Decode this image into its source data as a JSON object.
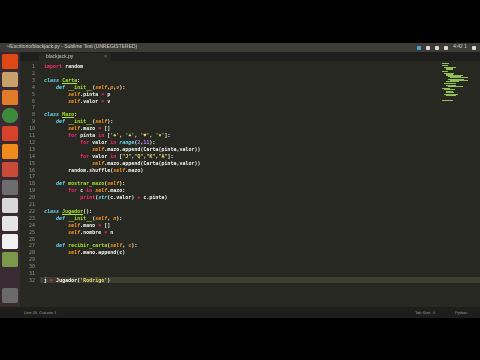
{
  "window": {
    "title": "~/Escritorio/blackjack.py - Sublime Text (UNREGISTERED)",
    "tray_time": "4:42 1"
  },
  "tabs": [
    {
      "label": "blackjack.py"
    }
  ],
  "editor": {
    "line_numbers": [
      "1",
      "2",
      "3",
      "4",
      "5",
      "6",
      "7",
      "8",
      "9",
      "10",
      "11",
      "12",
      "13",
      "14",
      "15",
      "16",
      "17",
      "18",
      "19",
      "20",
      "21",
      "22",
      "23",
      "24",
      "25",
      "26",
      "27",
      "28",
      "29",
      "30",
      "31",
      "32"
    ],
    "lines": [
      [
        {
          "t": "import",
          "c": "kw"
        },
        {
          "t": " random",
          "c": ""
        }
      ],
      [],
      [
        {
          "t": "class ",
          "c": "df"
        },
        {
          "t": "Carta",
          "c": "cls"
        },
        {
          "t": ":",
          "c": ""
        }
      ],
      [
        {
          "t": "    def ",
          "c": "df"
        },
        {
          "t": "__init__",
          "c": "fn"
        },
        {
          "t": "(",
          "c": ""
        },
        {
          "t": "self",
          "c": "pm"
        },
        {
          "t": ",",
          "c": ""
        },
        {
          "t": "p",
          "c": "pm"
        },
        {
          "t": ",",
          "c": ""
        },
        {
          "t": "v",
          "c": "pm"
        },
        {
          "t": "):",
          "c": ""
        }
      ],
      [
        {
          "t": "        self",
          "c": "slf"
        },
        {
          "t": ".pinta ",
          "c": ""
        },
        {
          "t": "=",
          "c": "kw"
        },
        {
          "t": " p",
          "c": ""
        }
      ],
      [
        {
          "t": "        self",
          "c": "slf"
        },
        {
          "t": ".valor ",
          "c": ""
        },
        {
          "t": "=",
          "c": "kw"
        },
        {
          "t": " v",
          "c": ""
        }
      ],
      [],
      [
        {
          "t": "class ",
          "c": "df"
        },
        {
          "t": "Mazo",
          "c": "cls"
        },
        {
          "t": ":",
          "c": ""
        }
      ],
      [
        {
          "t": "    def ",
          "c": "df"
        },
        {
          "t": "__init__",
          "c": "fn"
        },
        {
          "t": "(",
          "c": ""
        },
        {
          "t": "self",
          "c": "pm"
        },
        {
          "t": "):",
          "c": ""
        }
      ],
      [
        {
          "t": "        self",
          "c": "slf"
        },
        {
          "t": ".mazo ",
          "c": ""
        },
        {
          "t": "=",
          "c": "kw"
        },
        {
          "t": " []",
          "c": ""
        }
      ],
      [
        {
          "t": "        for",
          "c": "kw"
        },
        {
          "t": " pinta ",
          "c": ""
        },
        {
          "t": "in",
          "c": "kw"
        },
        {
          "t": " [",
          "c": ""
        },
        {
          "t": "'♠'",
          "c": "st"
        },
        {
          "t": ", ",
          "c": ""
        },
        {
          "t": "'♣'",
          "c": "st"
        },
        {
          "t": ", ",
          "c": ""
        },
        {
          "t": "'♥'",
          "c": "st"
        },
        {
          "t": ", ",
          "c": ""
        },
        {
          "t": "'♦'",
          "c": "st"
        },
        {
          "t": "]:",
          "c": ""
        }
      ],
      [
        {
          "t": "            for",
          "c": "kw"
        },
        {
          "t": " valor ",
          "c": ""
        },
        {
          "t": "in",
          "c": "kw"
        },
        {
          "t": " range",
          "c": "df"
        },
        {
          "t": "(",
          "c": ""
        },
        {
          "t": "2",
          "c": "nm"
        },
        {
          "t": ",",
          "c": ""
        },
        {
          "t": "11",
          "c": "nm"
        },
        {
          "t": "):",
          "c": ""
        }
      ],
      [
        {
          "t": "                self",
          "c": "slf"
        },
        {
          "t": ".mazo.append(Carta(pinta,valor))",
          "c": ""
        }
      ],
      [
        {
          "t": "            for",
          "c": "kw"
        },
        {
          "t": " valor ",
          "c": ""
        },
        {
          "t": "in",
          "c": "kw"
        },
        {
          "t": " [",
          "c": ""
        },
        {
          "t": "\"J\"",
          "c": "st"
        },
        {
          "t": ",",
          "c": ""
        },
        {
          "t": "\"Q\"",
          "c": "st"
        },
        {
          "t": ",",
          "c": ""
        },
        {
          "t": "\"K\"",
          "c": "st"
        },
        {
          "t": ",",
          "c": ""
        },
        {
          "t": "\"A\"",
          "c": "st"
        },
        {
          "t": "]:",
          "c": ""
        }
      ],
      [
        {
          "t": "                self",
          "c": "slf"
        },
        {
          "t": ".mazo.append(Carta(pinta,valor))",
          "c": ""
        }
      ],
      [
        {
          "t": "        random.shuffle(",
          "c": ""
        },
        {
          "t": "self",
          "c": "slf"
        },
        {
          "t": ".mazo)",
          "c": ""
        }
      ],
      [],
      [
        {
          "t": "    def ",
          "c": "df"
        },
        {
          "t": "mostrar_mazo",
          "c": "fn"
        },
        {
          "t": "(",
          "c": ""
        },
        {
          "t": "self",
          "c": "pm"
        },
        {
          "t": "):",
          "c": ""
        }
      ],
      [
        {
          "t": "        for",
          "c": "kw"
        },
        {
          "t": " c ",
          "c": ""
        },
        {
          "t": "in",
          "c": "kw"
        },
        {
          "t": " self",
          "c": "slf"
        },
        {
          "t": ".mazo:",
          "c": ""
        }
      ],
      [
        {
          "t": "            print",
          "c": "kw"
        },
        {
          "t": "(",
          "c": ""
        },
        {
          "t": "str",
          "c": "df"
        },
        {
          "t": "(c.valor) ",
          "c": ""
        },
        {
          "t": "+",
          "c": "kw"
        },
        {
          "t": " c.pinta)",
          "c": ""
        }
      ],
      [],
      [
        {
          "t": "class ",
          "c": "df"
        },
        {
          "t": "Jugador",
          "c": "cls"
        },
        {
          "t": "():",
          "c": ""
        }
      ],
      [
        {
          "t": "    def ",
          "c": "df"
        },
        {
          "t": "__init__",
          "c": "fn"
        },
        {
          "t": "(",
          "c": ""
        },
        {
          "t": "self",
          "c": "pm"
        },
        {
          "t": ", ",
          "c": ""
        },
        {
          "t": "n",
          "c": "pm"
        },
        {
          "t": "):",
          "c": ""
        }
      ],
      [
        {
          "t": "        self",
          "c": "slf"
        },
        {
          "t": ".mano ",
          "c": ""
        },
        {
          "t": "=",
          "c": "kw"
        },
        {
          "t": " []",
          "c": ""
        }
      ],
      [
        {
          "t": "        self",
          "c": "slf"
        },
        {
          "t": ".nombre ",
          "c": ""
        },
        {
          "t": "=",
          "c": "kw"
        },
        {
          "t": " n",
          "c": ""
        }
      ],
      [],
      [
        {
          "t": "    def ",
          "c": "df"
        },
        {
          "t": "recibir_carta",
          "c": "fn"
        },
        {
          "t": "(",
          "c": ""
        },
        {
          "t": "self",
          "c": "pm"
        },
        {
          "t": ", ",
          "c": ""
        },
        {
          "t": "c",
          "c": "pm"
        },
        {
          "t": "):",
          "c": ""
        }
      ],
      [
        {
          "t": "        self",
          "c": "slf"
        },
        {
          "t": ".mano.append(c)",
          "c": ""
        }
      ],
      [],
      [],
      [],
      [
        {
          "t": "j ",
          "c": ""
        },
        {
          "t": "=",
          "c": "kw"
        },
        {
          "t": " Jugador(",
          "c": ""
        },
        {
          "t": "'Rodrigo'",
          "c": "st"
        },
        {
          "t": ")",
          "c": ""
        }
      ]
    ]
  },
  "status": {
    "left": "Line 30, Column 1",
    "spaces": "Tab Size: 4",
    "syntax": "Python"
  },
  "colors": {
    "editor_bg": "#272822",
    "keyword": "#f92672",
    "string": "#e6db74",
    "function": "#a6e22e",
    "builtin": "#66d9ef",
    "param": "#fd971f",
    "number": "#ae81ff"
  },
  "launcher_icons": [
    "ubuntu-icon",
    "files-icon",
    "terminal-icon",
    "chrome-icon",
    "sublime-icon",
    "vlc-icon",
    "software-icon",
    "settings-icon",
    "impress-icon",
    "writer-icon",
    "calc-icon",
    "text-icon",
    "trash-icon"
  ]
}
